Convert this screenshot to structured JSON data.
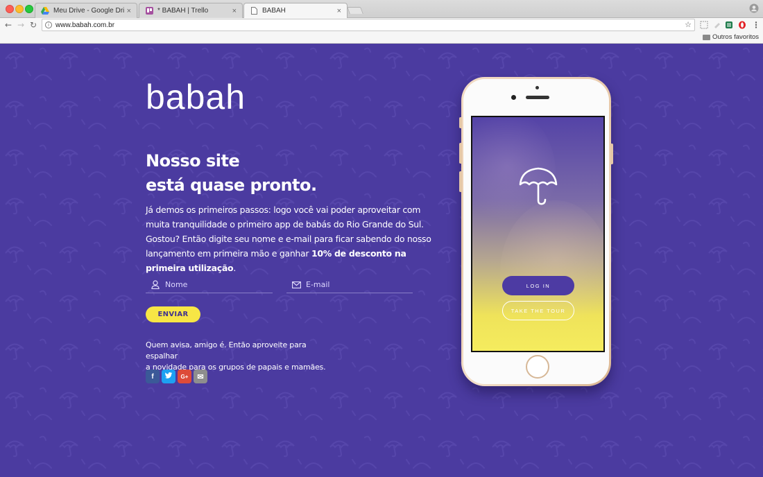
{
  "browser": {
    "tabs": [
      {
        "title": "Meu Drive - Google Drive",
        "close": "×",
        "icon": "google-drive-icon"
      },
      {
        "title": "* BABAH | Trello",
        "close": "×",
        "icon": "trello-icon"
      },
      {
        "title": "BABAH",
        "close": "×",
        "icon": "page-icon"
      }
    ],
    "url": "www.babah.com.br",
    "bookmarks": {
      "other": "Outros favoritos"
    }
  },
  "page": {
    "logo": "babah",
    "headline": {
      "line1": "Nosso site",
      "line2": "está quase pronto."
    },
    "intro": {
      "text": "Já demos os primeiros passos: logo você vai poder aproveitar com muita tranquilidade o primeiro app de babás do Rio Grande do Sul. Gostou? Então digite seu nome e e-mail para ficar sabendo do nosso lançamento em primeira mão e ganhar ",
      "highlight": "10% de desconto na primeira utilização",
      "end": "."
    },
    "form": {
      "name_placeholder": "Nome",
      "email_placeholder": "E-mail",
      "submit_label": "ENVIAR"
    },
    "share": {
      "line1": "Quem avisa, amigo é. Então aproveite para espalhar",
      "line2": "a novidade para os grupos de papais e mamães.",
      "buttons": [
        {
          "label": "f",
          "color": "#3b5998",
          "icon": "facebook-icon"
        },
        {
          "label": "t",
          "color": "#1da1f2",
          "icon": "twitter-icon"
        },
        {
          "label": "G+",
          "color": "#dd4b39",
          "icon": "google-plus-icon"
        },
        {
          "label": "✉",
          "color": "#8e8e8e",
          "icon": "email-icon"
        }
      ]
    },
    "phone": {
      "login_label": "LOG IN",
      "tour_label": "TAKE THE TOUR"
    }
  },
  "colors": {
    "background": "#4b3ba0",
    "accent_yellow": "#f7e645",
    "button_purple": "#4d3ba3"
  }
}
